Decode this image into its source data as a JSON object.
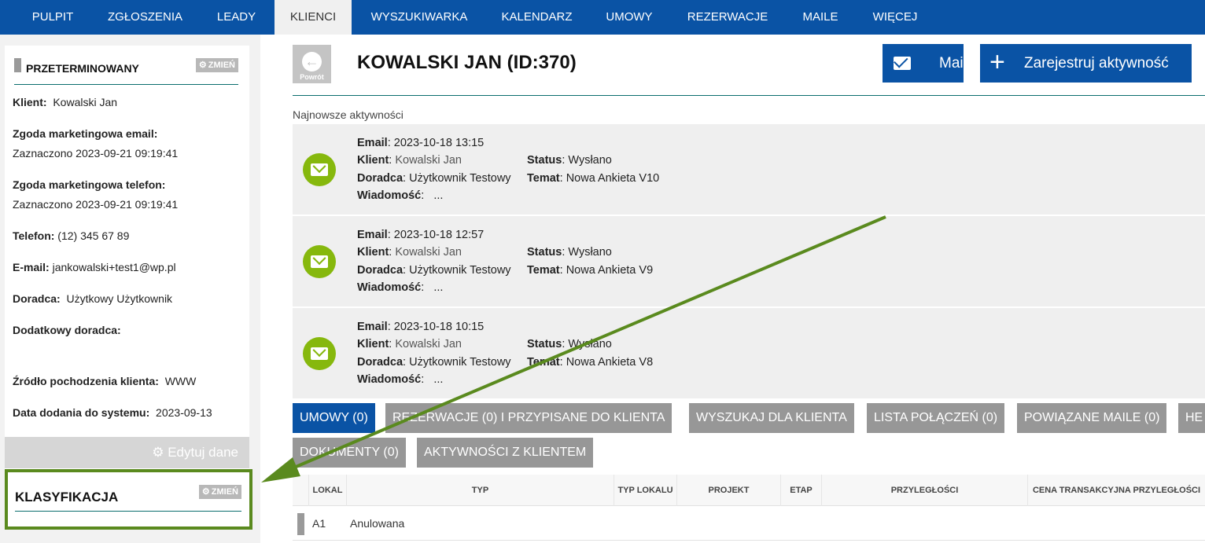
{
  "nav": {
    "items": [
      "PULPIT",
      "ZGŁOSZENIA",
      "LEADY",
      "KLIENCI",
      "WYSZUKIWARKA",
      "KALENDARZ",
      "UMOWY",
      "REZERWACJE",
      "MAILE",
      "WIĘCEJ"
    ],
    "active": "KLIENCI"
  },
  "sidebar": {
    "status_title": "PRZETERMINOWANY",
    "change_label": "ZMIEŃ",
    "fields": [
      {
        "label": "Klient:",
        "value": "Kowalski Jan"
      },
      {
        "label": "Zgoda marketingowa email:",
        "value": "Zaznaczono 2023-09-21 09:19:41"
      },
      {
        "label": "Zgoda marketingowa telefon:",
        "value": "Zaznaczono 2023-09-21 09:19:41"
      },
      {
        "label": "Telefon:",
        "value": "(12) 345 67 89"
      },
      {
        "label": "E-mail:",
        "value": "jankowalski+test1@wp.pl"
      },
      {
        "label": "Doradca:",
        "value": "Użytkowy Użytkownik"
      },
      {
        "label": "Dodatkowy doradca:",
        "value": ""
      },
      {
        "label": "Źródło pochodzenia klienta:",
        "value": "WWW"
      },
      {
        "label": "Data dodania do systemu:",
        "value": "2023-09-13"
      }
    ],
    "edit_label": "Edytuj dane",
    "klasyfikacja_title": "KLASYFIKACJA",
    "klasyfikacja_change": "ZMIEŃ"
  },
  "header": {
    "back_label": "Powrót",
    "title": "KOWALSKI JAN (ID:370)",
    "mail_button": "Mail",
    "register_button": "Zarejestruj aktywność"
  },
  "activities": {
    "label": "Najnowsze aktywności",
    "items": [
      {
        "email": "2023-10-18 13:15",
        "client": "Kowalski Jan",
        "advisor": "Użytkownik Testowy",
        "message": "...",
        "status": "Wysłano",
        "subject": "Nowa Ankieta V10"
      },
      {
        "email": "2023-10-18 12:57",
        "client": "Kowalski Jan",
        "advisor": "Użytkownik Testowy",
        "message": "...",
        "status": "Wysłano",
        "subject": "Nowa Ankieta V9"
      },
      {
        "email": "2023-10-18 10:15",
        "client": "Kowalski Jan",
        "advisor": "Użytkownik Testowy",
        "message": "...",
        "status": "Wysłano",
        "subject": "Nowa Ankieta V8"
      }
    ],
    "labels": {
      "email": "Email",
      "client": "Klient",
      "advisor": "Doradca",
      "message": "Wiadomość",
      "status": "Status",
      "subject": "Temat"
    }
  },
  "tabs": [
    "UMOWY (0)",
    "REZERWACJE (0) I PRZYPISANE DO KLIENTA",
    "WYSZUKAJ DLA KLIENTA",
    "LISTA POŁĄCZEŃ (0)",
    "POWIĄZANE MAILE (0)",
    "HE",
    "DOKUMENTY (0)",
    "AKTYWNOŚCI Z KLIENTEM"
  ],
  "table": {
    "headers": [
      "LOKAL",
      "TYP",
      "TYP LOKALU",
      "PROJEKT",
      "ETAP",
      "PRZYLEGŁOŚCI",
      "CENA TRANSAKCYJNA PRZYLEGŁOŚCI"
    ],
    "rows": [
      {
        "lokal": "A1",
        "typ": "Anulowana"
      }
    ]
  },
  "colors": {
    "nav": "#0a53a5",
    "primary_button": "#0a53a5",
    "activity_icon": "#86b80d",
    "annotation_arrow": "#5a8a1e",
    "tab_inactive": "#979797"
  }
}
